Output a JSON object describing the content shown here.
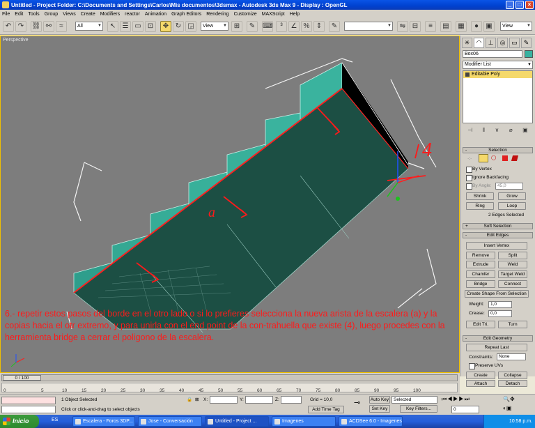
{
  "window": {
    "title": "Untitled    - Project Folder: C:\\Documents and Settings\\Carlos\\Mis documentos\\3dsmax    - Autodesk 3ds Max 9    - Display : OpenGL"
  },
  "menu": [
    "File",
    "Edit",
    "Tools",
    "Group",
    "Views",
    "Create",
    "Modifiers",
    "reactor",
    "Animation",
    "Graph Editors",
    "Rendering",
    "Customize",
    "MAXScript",
    "Help"
  ],
  "toolbar": {
    "filter_select": "All",
    "coord_select": "View",
    "right_select": "View",
    "named_sel_empty": ""
  },
  "viewport": {
    "label": "Perspective",
    "annotation_a": "a",
    "annotation_4": "4",
    "instructions": "6.- repetir estos pasos del borde en el otro lado o si lo prefieres selecciona la nueva arista de la escalera (a) y la copias hacia el otr extremo, y para unirla con el end point de la con-trahuella que existe (4), luego procedes con la herramienta bridge a cerrar el poligono de la escalera."
  },
  "command_panel": {
    "object_name": "Box06",
    "modifier_list": "Modifier List",
    "stack_item": "Editable Poly",
    "selection": {
      "title": "Selection",
      "by_vertex": "By Vertex",
      "ignore_backfacing": "Ignore Backfacing",
      "by_angle": "By Angle:",
      "angle_value": "45,0",
      "shrink": "Shrink",
      "grow": "Grow",
      "ring": "Ring",
      "loop": "Loop",
      "status": "2 Edges Selected"
    },
    "soft_selection": "Soft Selection",
    "edit_edges": {
      "title": "Edit Edges",
      "insert_vertex": "Insert Vertex",
      "remove": "Remove",
      "split": "Split",
      "extrude": "Extrude",
      "weld": "Weld",
      "chamfer": "Chamfer",
      "target_weld": "Target Weld",
      "bridge": "Bridge",
      "connect": "Connect",
      "create_shape": "Create Shape From Selection",
      "weight_label": "Weight:",
      "weight_value": "1,0",
      "crease_label": "Crease:",
      "crease_value": "0,0",
      "edit_tri": "Edit Tri.",
      "turn": "Turn"
    },
    "edit_geometry": {
      "title": "Edit Geometry",
      "repeat_last": "Repeat Last",
      "constraints_label": "Constraints:",
      "constraints_value": "None",
      "preserve_uvs": "Preserve UVs",
      "create": "Create",
      "collapse": "Collapse",
      "attach": "Attach",
      "detach": "Detach"
    }
  },
  "timeline": {
    "slider": "0 / 100",
    "ticks": [
      "0",
      "5",
      "10",
      "15",
      "20",
      "25",
      "30",
      "35",
      "40",
      "45",
      "50",
      "55",
      "60",
      "65",
      "70",
      "75",
      "80",
      "85",
      "90",
      "95",
      "100"
    ]
  },
  "status": {
    "selected": "1 Object Selected",
    "prompt": "Click or click-and-drag to select objects",
    "x_label": "X:",
    "y_label": "Y:",
    "z_label": "Z:",
    "grid": "Grid = 10,0",
    "add_time_tag": "Add Time Tag",
    "auto_key": "Auto Key",
    "set_key": "Set Key",
    "selected_dropdown": "Selected",
    "key_filters": "Key Filters...",
    "frame": "0"
  },
  "taskbar": {
    "start": "Inicio",
    "lang": "ES",
    "tasks": [
      "Escalera - Foros 3DP...",
      "Jose - Conversación",
      "Untitled     - Project ...",
      "Imagenes",
      "ACDSee 6.0 - Imagenes"
    ],
    "clock": "10:58 p.m."
  }
}
